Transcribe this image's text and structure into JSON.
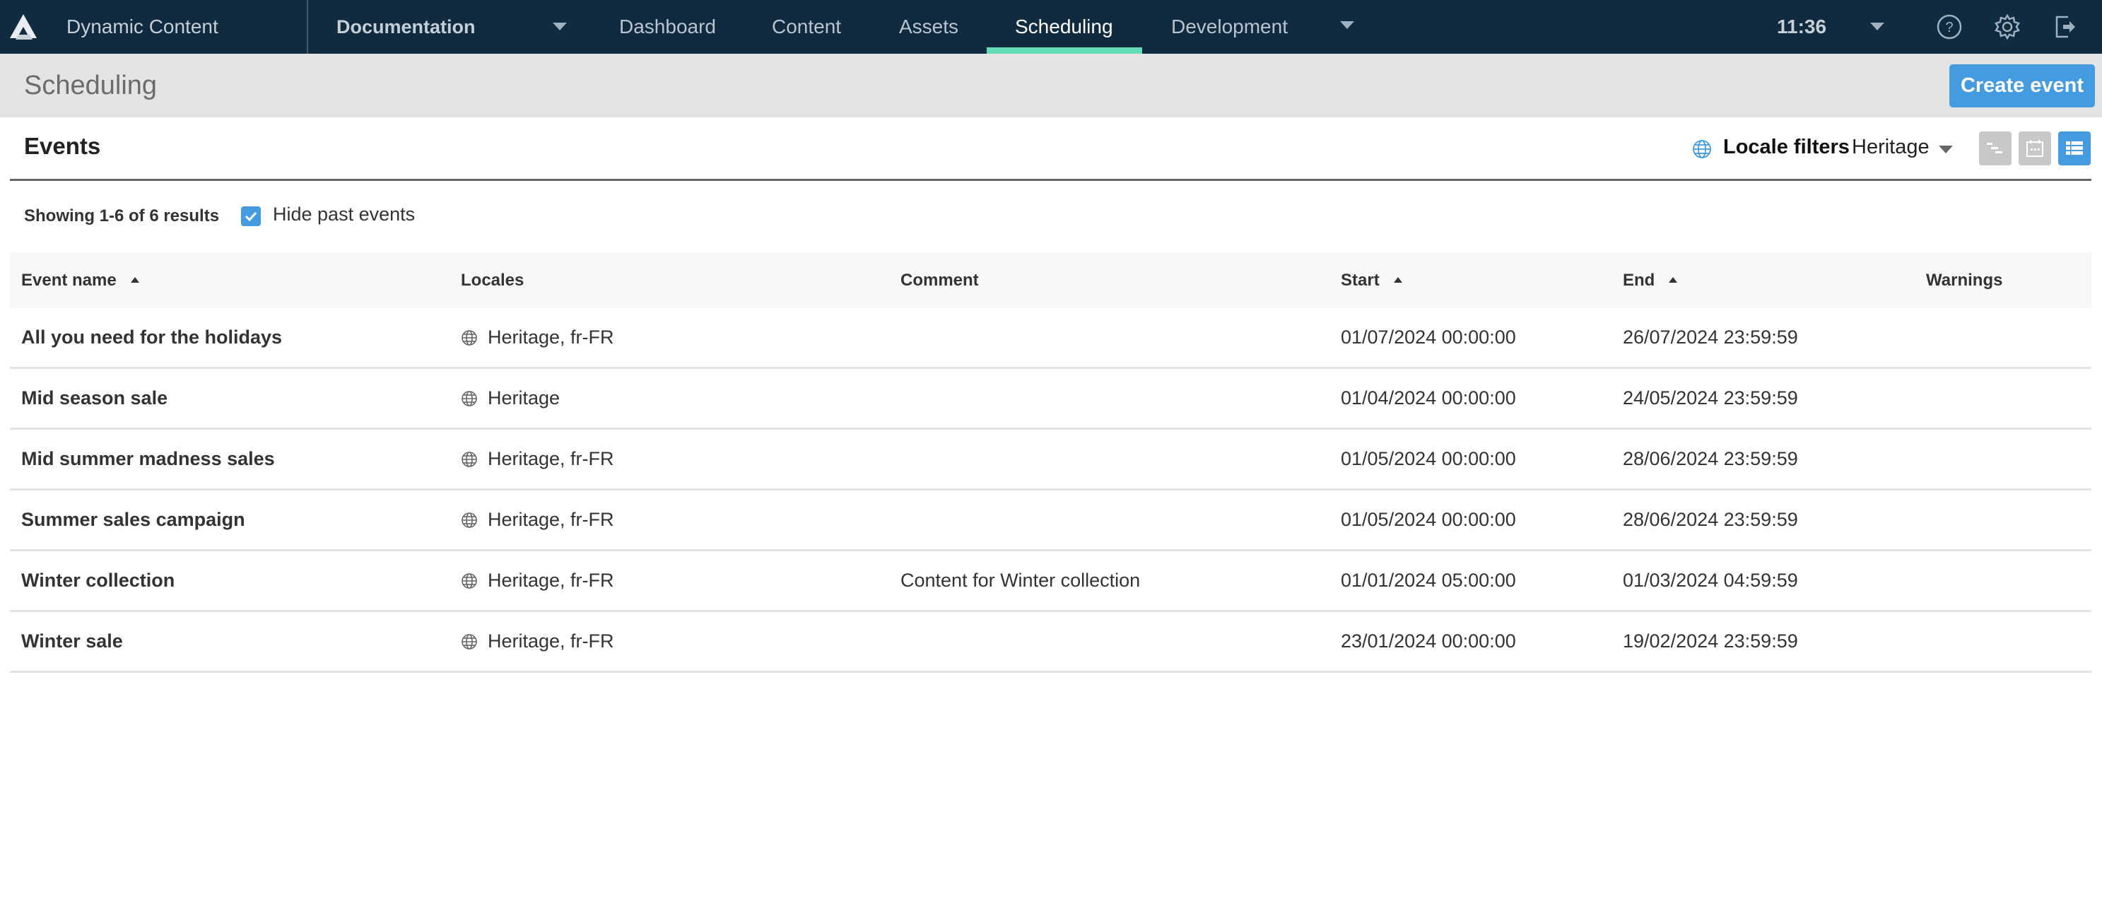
{
  "app": {
    "title": "Dynamic Content",
    "hub": "Documentation",
    "time": "11:36"
  },
  "nav": {
    "items": [
      {
        "label": "Dashboard",
        "active": false
      },
      {
        "label": "Content",
        "active": false
      },
      {
        "label": "Assets",
        "active": false
      },
      {
        "label": "Scheduling",
        "active": true
      },
      {
        "label": "Development",
        "active": false
      }
    ],
    "icons": [
      "help-icon",
      "settings-icon",
      "logout-icon"
    ]
  },
  "page": {
    "title": "Scheduling",
    "create_label": "Create event"
  },
  "events": {
    "title": "Events",
    "locale_filter_label": "Locale filters",
    "locale_filter_value": "Heritage",
    "view_modes": [
      "timeline",
      "calendar",
      "list"
    ],
    "active_view": "list",
    "showing": "Showing 1-6 of 6 results",
    "hide_past_label": "Hide past events",
    "hide_past_checked": true
  },
  "table": {
    "columns": [
      {
        "label": "Event name",
        "sorted": true
      },
      {
        "label": "Locales",
        "sorted": false
      },
      {
        "label": "Comment",
        "sorted": false
      },
      {
        "label": "Start",
        "sorted": true
      },
      {
        "label": "End",
        "sorted": true
      },
      {
        "label": "Warnings",
        "sorted": false
      }
    ],
    "rows": [
      {
        "name": "All you need for the holidays",
        "locales": "Heritage, fr-FR",
        "comment": "",
        "start": "01/07/2024 00:00:00",
        "end": "26/07/2024 23:59:59",
        "warnings": ""
      },
      {
        "name": "Mid season sale",
        "locales": "Heritage",
        "comment": "",
        "start": "01/04/2024 00:00:00",
        "end": "24/05/2024 23:59:59",
        "warnings": ""
      },
      {
        "name": "Mid summer madness sales",
        "locales": "Heritage, fr-FR",
        "comment": "",
        "start": "01/05/2024 00:00:00",
        "end": "28/06/2024 23:59:59",
        "warnings": ""
      },
      {
        "name": "Summer sales campaign",
        "locales": "Heritage, fr-FR",
        "comment": "",
        "start": "01/05/2024 00:00:00",
        "end": "28/06/2024 23:59:59",
        "warnings": ""
      },
      {
        "name": "Winter collection",
        "locales": "Heritage, fr-FR",
        "comment": "Content for Winter collection",
        "start": "01/01/2024 05:00:00",
        "end": "01/03/2024 04:59:59",
        "warnings": ""
      },
      {
        "name": "Winter sale",
        "locales": "Heritage, fr-FR",
        "comment": "",
        "start": "23/01/2024 00:00:00",
        "end": "19/02/2024 23:59:59",
        "warnings": ""
      }
    ]
  },
  "colors": {
    "topbar": "#102a40",
    "accent": "#449bdf",
    "active_tab_underline": "#63dbb7",
    "header_bg": "#e4e4e4"
  }
}
